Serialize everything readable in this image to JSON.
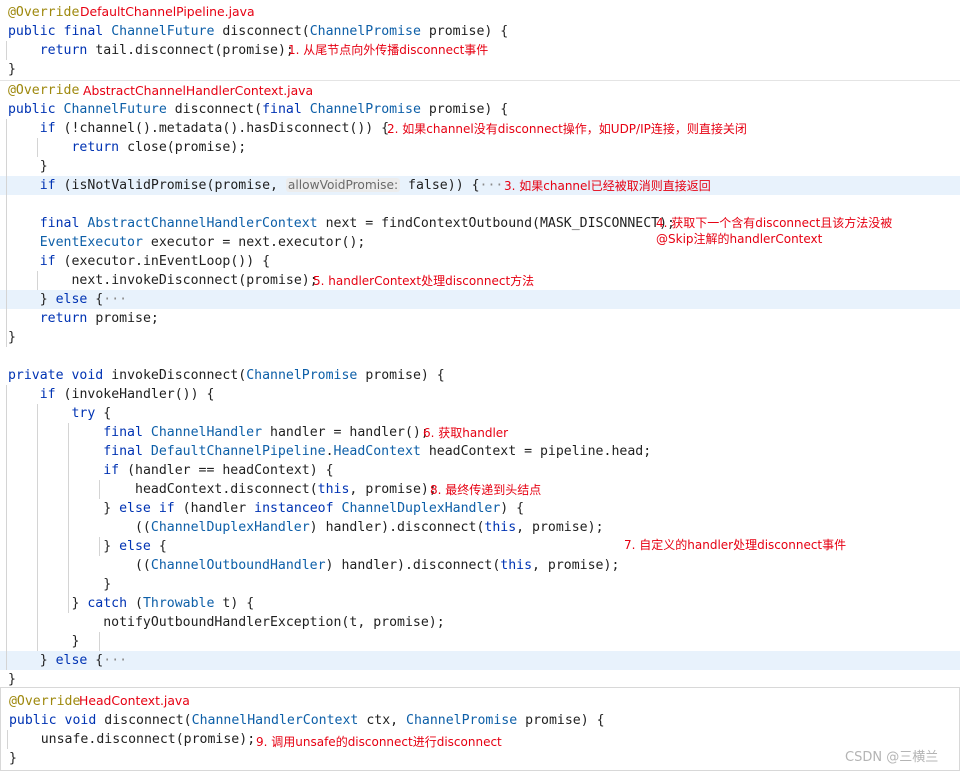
{
  "annotations": [
    "DefaultChannelPipeline.java",
    "1. 从尾节点向外传播disconnect事件",
    "AbstractChannelHandlerContext.java",
    "2. 如果channel没有disconnect操作，如UDP/IP连接，则直接关闭",
    "3. 如果channel已经被取消则直接返回",
    "4. 获取下一个含有disconnect且该方法没被",
    "@Skip注解的handlerContext",
    "5. handlerContext处理disconnect方法",
    "6. 获取handler",
    "8. 最终传递到头结点",
    "7. 自定义的handler处理disconnect事件",
    "HeadContext.java",
    "9. 调用unsafe的disconnect进行disconnect"
  ],
  "watermark": "CSDN @三横兰",
  "code_lines": [
    [
      "@Override"
    ],
    [
      "public final ChannelFuture disconnect(ChannelPromise promise) {"
    ],
    [
      "    return tail.disconnect(promise);"
    ],
    [
      "}"
    ],
    [
      "@Override"
    ],
    [
      "public ChannelFuture disconnect(final ChannelPromise promise) {"
    ],
    [
      "    if (!channel().metadata().hasDisconnect()) {"
    ],
    [
      "        return close(promise);"
    ],
    [
      "    }"
    ],
    [
      "    if (isNotValidPromise(promise, ",
      "allowVoidPromise:",
      " false)) {",
      "···"
    ],
    [
      "    final AbstractChannelHandlerContext next = findContextOutbound(MASK_DISCONNECT);"
    ],
    [
      "    EventExecutor executor = next.executor();"
    ],
    [
      "    if (executor.inEventLoop()) {"
    ],
    [
      "        next.invokeDisconnect(promise);"
    ],
    [
      "    } else {",
      "···"
    ],
    [
      "    return promise;"
    ],
    [
      "}"
    ],
    [
      "private void invokeDisconnect(ChannelPromise promise) {"
    ],
    [
      "    if (invokeHandler()) {"
    ],
    [
      "        try {"
    ],
    [
      "            final ChannelHandler handler = handler();"
    ],
    [
      "            final DefaultChannelPipeline.HeadContext headContext = pipeline.head;"
    ],
    [
      "            if (handler == headContext) {"
    ],
    [
      "                headContext.disconnect(this, promise);"
    ],
    [
      "            } else if (handler instanceof ChannelDuplexHandler) {"
    ],
    [
      "                ((ChannelDuplexHandler) handler).disconnect(this, promise);"
    ],
    [
      "            } else {"
    ],
    [
      "                ((ChannelOutboundHandler) handler).disconnect(this, promise);"
    ],
    [
      "            }"
    ],
    [
      "        } catch (Throwable t) {"
    ],
    [
      "            notifyOutboundHandlerException(t, promise);"
    ],
    [
      "        }"
    ],
    [
      "    } else {",
      "···"
    ],
    [
      "}"
    ],
    [
      "@Override"
    ],
    [
      "public void disconnect(ChannelHandlerContext ctx, ChannelPromise promise) {"
    ],
    [
      "    unsafe.disconnect(promise);"
    ],
    [
      "}"
    ]
  ]
}
